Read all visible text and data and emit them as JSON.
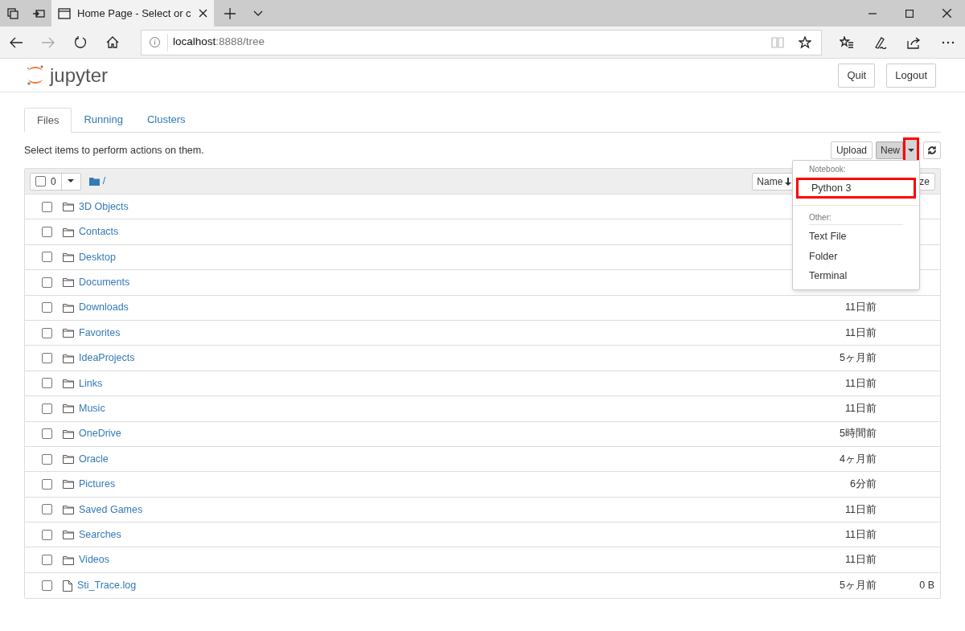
{
  "browser": {
    "tab_title": "Home Page - Select or c",
    "address_host": "localhost",
    "address_path": ":8888/tree"
  },
  "header": {
    "logo_text": "jupyter",
    "buttons": [
      "Quit",
      "Logout"
    ]
  },
  "tabs": [
    {
      "label": "Files",
      "selected": true
    },
    {
      "label": "Running",
      "selected": false
    },
    {
      "label": "Clusters",
      "selected": false
    }
  ],
  "instructions": "Select items to perform actions on them.",
  "toolbar": {
    "upload": "Upload",
    "new": "New",
    "new_open": true,
    "caret_highlighted": true
  },
  "list_header": {
    "checked": false,
    "selected_count": "0",
    "path": "/",
    "sort_button": "Name",
    "size_header": "ze"
  },
  "rows": [
    {
      "kind": "folder",
      "checked": false,
      "name": "3D Objects"
    },
    {
      "kind": "folder",
      "checked": false,
      "name": "Contacts"
    },
    {
      "kind": "folder",
      "checked": false,
      "name": "Desktop"
    },
    {
      "kind": "folder",
      "checked": false,
      "name": "Documents"
    },
    {
      "kind": "folder",
      "checked": false,
      "name": "Downloads",
      "modified": "11日前"
    },
    {
      "kind": "folder",
      "checked": false,
      "name": "Favorites",
      "modified": "11日前"
    },
    {
      "kind": "folder",
      "checked": false,
      "name": "IdeaProjects",
      "modified": "5ヶ月前"
    },
    {
      "kind": "folder",
      "checked": false,
      "name": "Links",
      "modified": "11日前"
    },
    {
      "kind": "folder",
      "checked": false,
      "name": "Music",
      "modified": "11日前"
    },
    {
      "kind": "folder",
      "checked": false,
      "name": "OneDrive",
      "modified": "5時間前"
    },
    {
      "kind": "folder",
      "checked": false,
      "name": "Oracle",
      "modified": "4ヶ月前"
    },
    {
      "kind": "folder",
      "checked": false,
      "name": "Pictures",
      "modified": "6分前"
    },
    {
      "kind": "folder",
      "checked": false,
      "name": "Saved Games",
      "modified": "11日前"
    },
    {
      "kind": "folder",
      "checked": false,
      "name": "Searches",
      "modified": "11日前"
    },
    {
      "kind": "folder",
      "checked": false,
      "name": "Videos",
      "modified": "11日前"
    },
    {
      "kind": "file",
      "checked": false,
      "name": "Sti_Trace.log",
      "modified": "5ヶ月前",
      "size": "0 B"
    }
  ],
  "new_menu": [
    {
      "kind": "header",
      "label": "Notebook:"
    },
    {
      "kind": "item",
      "label": "Python 3",
      "highlighted": true
    },
    {
      "kind": "divider"
    },
    {
      "kind": "header",
      "label": "Other:"
    },
    {
      "kind": "item",
      "label": "Text File",
      "highlighted": false
    },
    {
      "kind": "item",
      "label": "Folder",
      "highlighted": false
    },
    {
      "kind": "item",
      "label": "Terminal",
      "highlighted": false
    }
  ]
}
